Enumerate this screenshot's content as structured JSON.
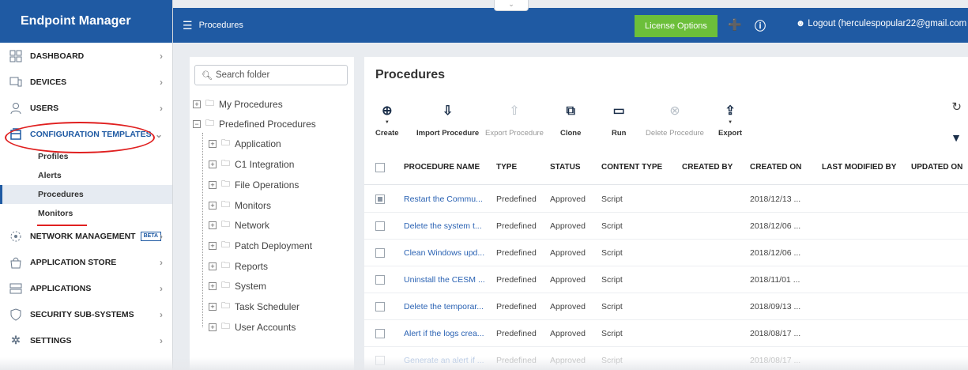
{
  "app": {
    "title": "Endpoint Manager"
  },
  "sidebar": {
    "items": [
      {
        "label": "DASHBOARD",
        "icon": "dashboard-icon"
      },
      {
        "label": "DEVICES",
        "icon": "devices-icon"
      },
      {
        "label": "USERS",
        "icon": "users-icon"
      },
      {
        "label": "CONFIGURATION TEMPLATES",
        "icon": "templates-icon"
      },
      {
        "label": "NETWORK MANAGEMENT",
        "icon": "network-icon",
        "badge": "BETA"
      },
      {
        "label": "APPLICATION STORE",
        "icon": "store-icon"
      },
      {
        "label": "APPLICATIONS",
        "icon": "applications-icon"
      },
      {
        "label": "SECURITY SUB-SYSTEMS",
        "icon": "shield-icon"
      },
      {
        "label": "SETTINGS",
        "icon": "gear-icon"
      }
    ],
    "subitems": [
      "Profiles",
      "Alerts",
      "Procedures",
      "Monitors"
    ],
    "active_subitem": "Procedures"
  },
  "header": {
    "breadcrumb": "Procedures",
    "license_button": "License Options",
    "logout": "Logout (herculespopular22@gmail.com"
  },
  "folders": {
    "search_placeholder": "Search folder",
    "roots": [
      "My Procedures",
      "Predefined Procedures"
    ],
    "children": [
      "Application",
      "C1 Integration",
      "File Operations",
      "Monitors",
      "Network",
      "Patch Deployment",
      "Reports",
      "System",
      "Task Scheduler",
      "User Accounts"
    ]
  },
  "main": {
    "title": "Procedures",
    "toolbar": [
      {
        "label": "Create",
        "icon": "create-icon",
        "enabled": true,
        "dropdown": true
      },
      {
        "label": "Import Procedure",
        "icon": "import-icon",
        "enabled": true
      },
      {
        "label": "Export Procedure",
        "icon": "export-procedure-icon",
        "enabled": false
      },
      {
        "label": "Clone",
        "icon": "clone-icon",
        "enabled": true
      },
      {
        "label": "Run",
        "icon": "run-icon",
        "enabled": true
      },
      {
        "label": "Delete Procedure",
        "icon": "delete-icon",
        "enabled": false
      },
      {
        "label": "Export",
        "icon": "export-icon",
        "enabled": true,
        "dropdown": true
      }
    ],
    "columns": [
      "PROCEDURE NAME",
      "TYPE",
      "STATUS",
      "CONTENT TYPE",
      "CREATED BY",
      "CREATED ON",
      "LAST MODIFIED BY",
      "UPDATED ON"
    ],
    "rows": [
      {
        "name": "Restart the Commu...",
        "type": "Predefined",
        "status": "Approved",
        "content_type": "Script",
        "created_by": "",
        "created_on": "2018/12/13 ...",
        "last_modified_by": "",
        "updated_on": "",
        "checked": true
      },
      {
        "name": "Delete the system t...",
        "type": "Predefined",
        "status": "Approved",
        "content_type": "Script",
        "created_by": "",
        "created_on": "2018/12/06 ...",
        "last_modified_by": "",
        "updated_on": "",
        "checked": false
      },
      {
        "name": "Clean Windows upd...",
        "type": "Predefined",
        "status": "Approved",
        "content_type": "Script",
        "created_by": "",
        "created_on": "2018/12/06 ...",
        "last_modified_by": "",
        "updated_on": "",
        "checked": false
      },
      {
        "name": "Uninstall the CESM ...",
        "type": "Predefined",
        "status": "Approved",
        "content_type": "Script",
        "created_by": "",
        "created_on": "2018/11/01 ...",
        "last_modified_by": "",
        "updated_on": "",
        "checked": false
      },
      {
        "name": "Delete the temporar...",
        "type": "Predefined",
        "status": "Approved",
        "content_type": "Script",
        "created_by": "",
        "created_on": "2018/09/13 ...",
        "last_modified_by": "",
        "updated_on": "",
        "checked": false
      },
      {
        "name": "Alert if the logs crea...",
        "type": "Predefined",
        "status": "Approved",
        "content_type": "Script",
        "created_by": "",
        "created_on": "2018/08/17 ...",
        "last_modified_by": "",
        "updated_on": "",
        "checked": false
      },
      {
        "name": "Generate an alert if ...",
        "type": "Predefined",
        "status": "Approved",
        "content_type": "Script",
        "created_by": "",
        "created_on": "2018/08/17 ...",
        "last_modified_by": "",
        "updated_on": "",
        "checked": false
      }
    ]
  },
  "colors": {
    "brand": "#1f5aa3",
    "license": "#6cbf3a",
    "link": "#2a62b3",
    "annotation": "#e02020"
  }
}
